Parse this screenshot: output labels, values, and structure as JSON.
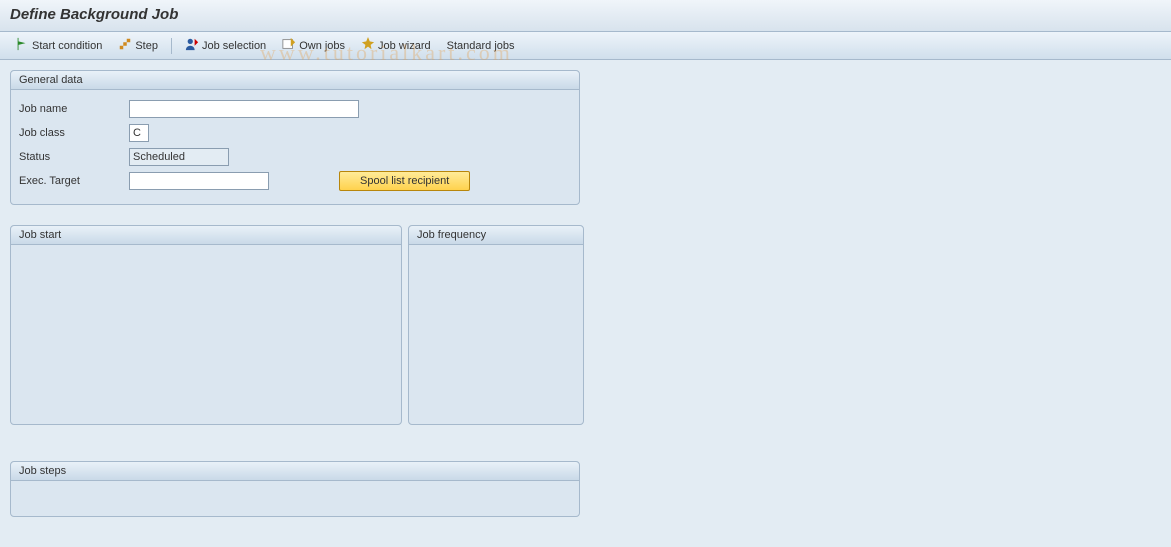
{
  "title": "Define Background Job",
  "toolbar": {
    "start_condition": "Start condition",
    "step": "Step",
    "job_selection": "Job selection",
    "own_jobs": "Own jobs",
    "job_wizard": "Job wizard",
    "standard_jobs": "Standard jobs"
  },
  "general": {
    "title": "General data",
    "job_name_label": "Job name",
    "job_name_value": "",
    "job_class_label": "Job class",
    "job_class_value": "C",
    "status_label": "Status",
    "status_value": "Scheduled",
    "exec_target_label": "Exec. Target",
    "exec_target_value": "",
    "spool_btn": "Spool list recipient"
  },
  "job_start": {
    "title": "Job start"
  },
  "job_frequency": {
    "title": "Job frequency"
  },
  "job_steps": {
    "title": "Job steps"
  },
  "watermark": "www.tutorialkart.com"
}
